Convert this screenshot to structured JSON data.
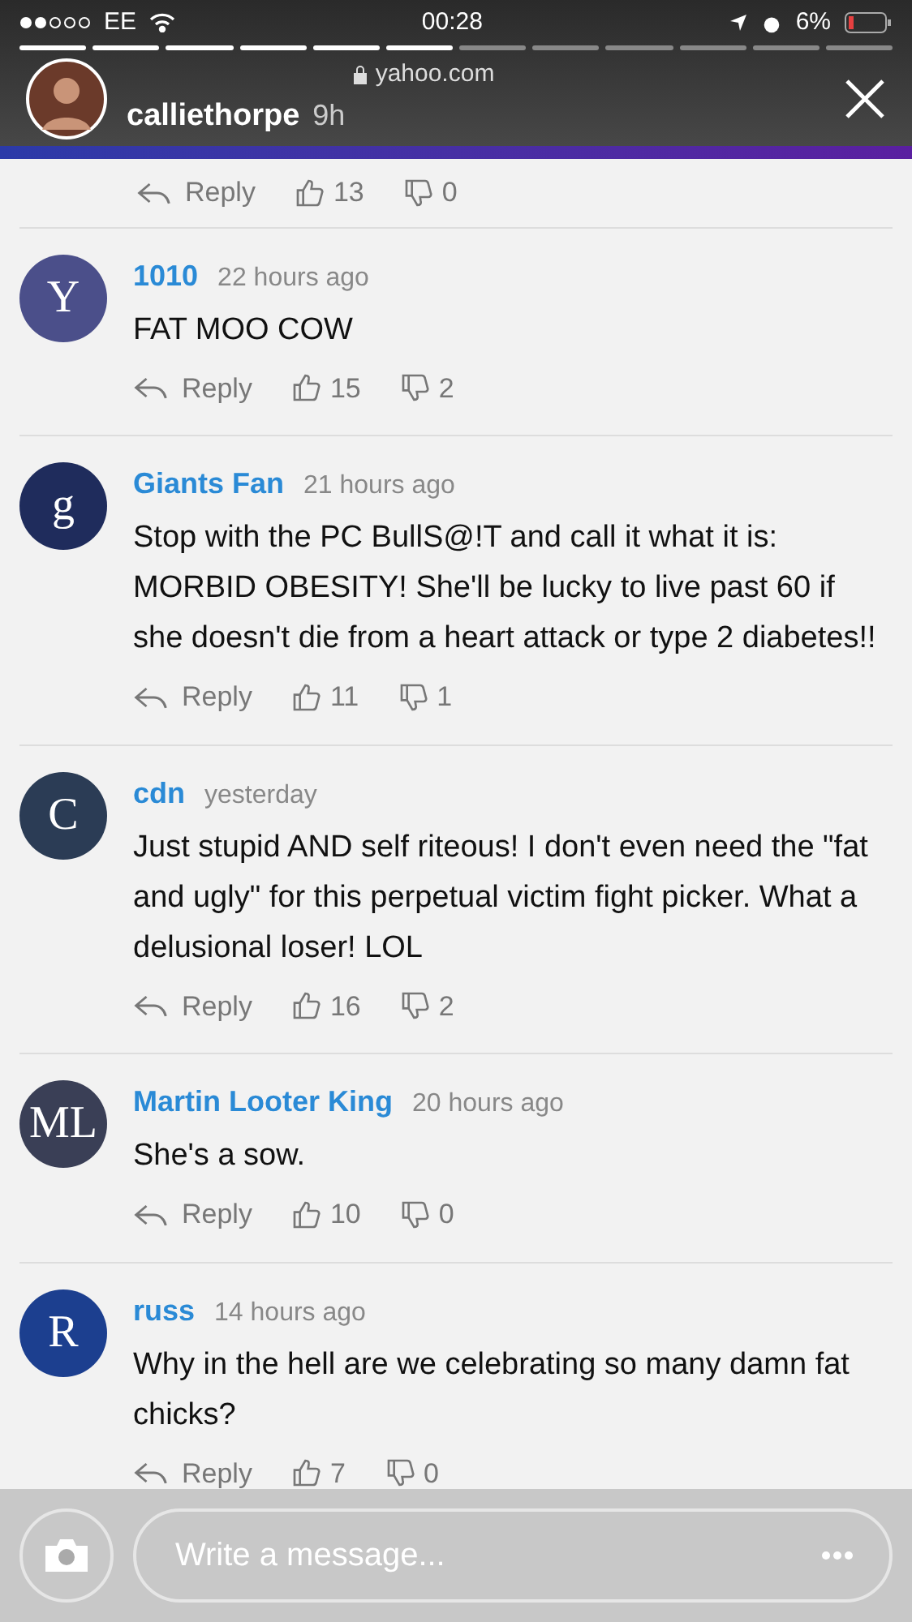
{
  "status_bar": {
    "carrier": "EE",
    "time": "00:28",
    "battery": "6%"
  },
  "story": {
    "url": "yahoo.com",
    "user": "calliethorpe",
    "age": "9h"
  },
  "top_actions": {
    "reply": "Reply",
    "likes": "13",
    "dislikes": "0"
  },
  "comments": [
    {
      "avatar": "Y",
      "color": "#4b4f8a",
      "name": "1010",
      "time": "22 hours ago",
      "text": "FAT MOO COW",
      "reply": "Reply",
      "likes": "15",
      "dislikes": "2"
    },
    {
      "avatar": "g",
      "color": "#1f2c5c",
      "name": "Giants Fan",
      "time": "21 hours ago",
      "text": "Stop with the PC BullS@!T and call it what it is: MORBID OBESITY! She'll be lucky to live past 60 if she doesn't die from a heart attack or type 2 diabetes!!",
      "reply": "Reply",
      "likes": "11",
      "dislikes": "1"
    },
    {
      "avatar": "C",
      "color": "#2b3c55",
      "name": "cdn",
      "time": "yesterday",
      "text": "Just stupid AND self riteous! I don't even need the \"fat and ugly\" for this perpetual victim fight picker. What a delusional loser! LOL",
      "reply": "Reply",
      "likes": "16",
      "dislikes": "2"
    },
    {
      "avatar": "ML",
      "color": "#3a3f56",
      "name": "Martin Looter King",
      "time": "20 hours ago",
      "text": "She's a sow.",
      "reply": "Reply",
      "likes": "10",
      "dislikes": "0"
    },
    {
      "avatar": "R",
      "color": "#1c3f8f",
      "name": "russ",
      "time": "14 hours ago",
      "text": "Why in the hell are we celebrating so many damn fat chicks?",
      "reply": "Reply",
      "likes": "7",
      "dislikes": "0"
    }
  ],
  "message": {
    "placeholder": "Write a message..."
  }
}
